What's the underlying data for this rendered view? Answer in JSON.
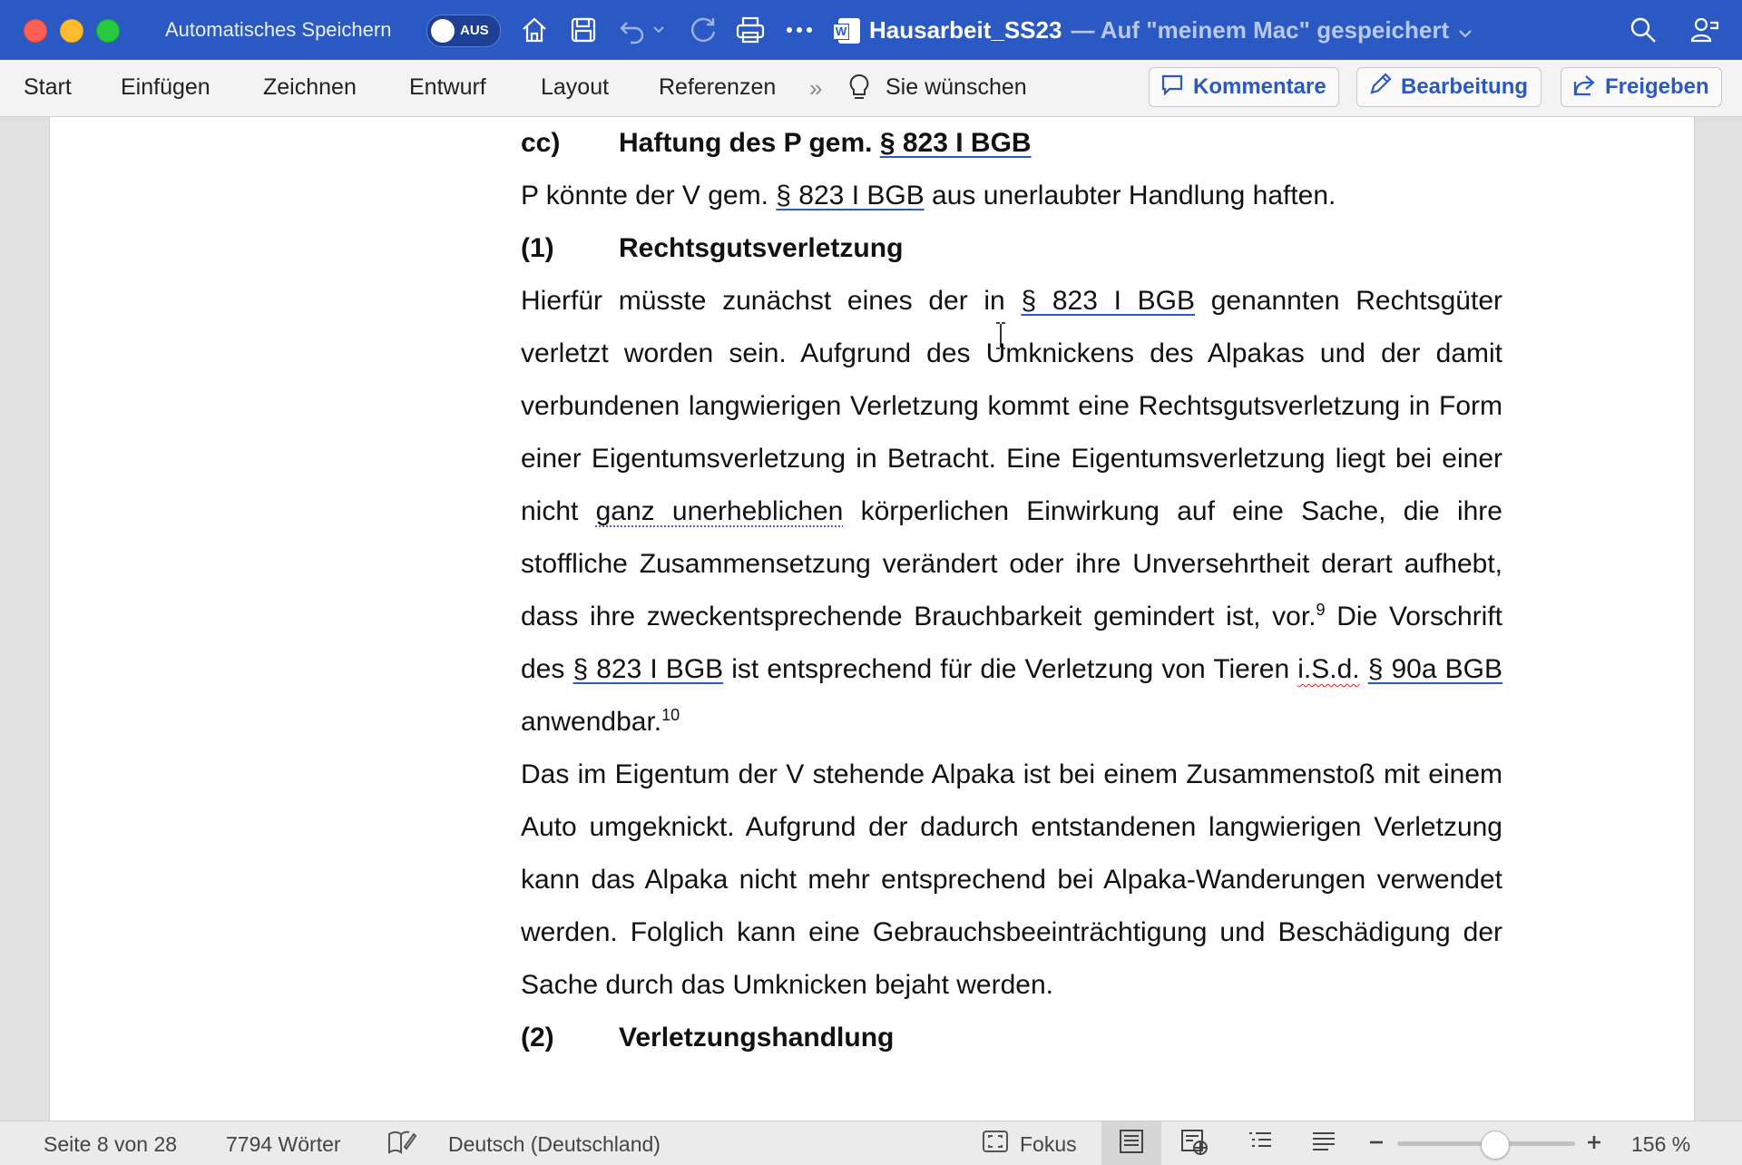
{
  "titlebar": {
    "autosave_label": "Automatisches Speichern",
    "autosave_toggle": "AUS",
    "document_name": "Hausarbeit_SS23",
    "save_location": "— Auf \"meinem Mac\" gespeichert"
  },
  "ribbon": {
    "tabs": [
      "Start",
      "Einfügen",
      "Zeichnen",
      "Entwurf",
      "Layout",
      "Referenzen"
    ],
    "tell_me": "Sie wünschen",
    "comments_button": "Kommentare",
    "editing_button": "Bearbeitung",
    "share_button": "Freigeben"
  },
  "document": {
    "heading_cc_num": "cc)",
    "heading_cc_pre": "Haftung des P gem. ",
    "heading_cc_link": "§ 823 I BGB",
    "para1_pre": "P könnte der V gem. ",
    "para1_link": "§ 823 I BGB",
    "para1_post": " aus unerlaubter Handlung haften.",
    "heading1_num": "(1)",
    "heading1_text": "Rechtsgutsverletzung",
    "para2_a": "Hierfür müsste zunächst eines der in ",
    "para2_link1": "§ 823 I BGB",
    "para2_b": " genannten Rechtsgüter verletzt worden sein. Aufgrund des Umknickens des Alpakas und der damit verbundenen langwierigen Verletzung kommt eine Rechtsgutsverletzung in Form einer Eigentumsverletzung in Betracht. Eine Eigentumsverletzung liegt bei einer nicht ",
    "para2_dotted": "ganz unerheblichen",
    "para2_c": " körperlichen Einwirkung auf eine Sache, die ihre stoffliche Zusammensetzung verändert oder ihre Unversehrtheit derart aufhebt, dass ihre zweckentsprechende Brauchbarkeit gemindert ist, vor.",
    "footnote9": "9",
    "para2_d": " Die Vorschrift des ",
    "para2_link2": "§ 823 I BGB",
    "para2_e": " ist entsprechend für die Verletzung von Tieren ",
    "para2_wavy": "i.S.d.",
    "para2_f": " ",
    "para2_link3": "§ 90a BGB",
    "para2_g": " anwendbar.",
    "footnote10": "10",
    "para3": "Das im Eigentum der V stehende Alpaka ist bei einem Zusammenstoß mit einem Auto umgeknickt. Aufgrund der dadurch entstandenen langwierigen Verletzung kann das Alpaka nicht mehr entsprechend bei Alpaka-Wanderungen verwendet werden. Folglich kann eine Gebrauchsbeeinträchtigung und Beschädigung der Sache durch das Umknicken bejaht werden.",
    "heading2_num": "(2)",
    "heading2_text": "Verletzungshandlung"
  },
  "statusbar": {
    "page": "Seite 8 von 28",
    "words": "7794 Wörter",
    "language": "Deutsch (Deutschland)",
    "focus": "Fokus",
    "zoom": "156 %"
  },
  "colors": {
    "titlebar": "#2b59c3",
    "accent": "#2b59c3",
    "link_underline": "#2b59c3"
  }
}
